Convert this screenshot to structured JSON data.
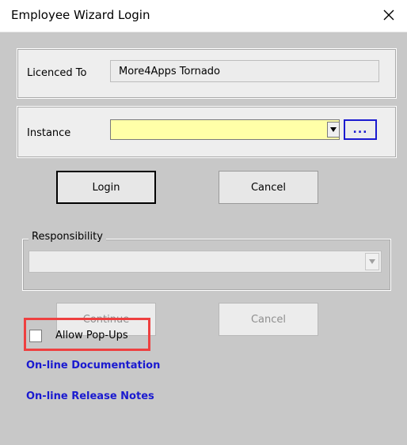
{
  "window": {
    "title": "Employee Wizard Login"
  },
  "license": {
    "label": "Licenced To",
    "value": "More4Apps Tornado"
  },
  "instance": {
    "label": "Instance",
    "value": "",
    "browse_label": "..."
  },
  "buttons": {
    "login": "Login",
    "cancel": "Cancel",
    "continue": "Continue",
    "cancel2": "Cancel"
  },
  "responsibility": {
    "legend": "Responsibility",
    "value": ""
  },
  "popups": {
    "label": "Allow Pop-Ups",
    "checked": false
  },
  "links": {
    "documentation": "On-line Documentation",
    "release_notes": "On-line Release Notes"
  },
  "colors": {
    "highlight": "#ee4040",
    "link": "#1a1ad0",
    "instance_bg": "#ffffa8"
  }
}
